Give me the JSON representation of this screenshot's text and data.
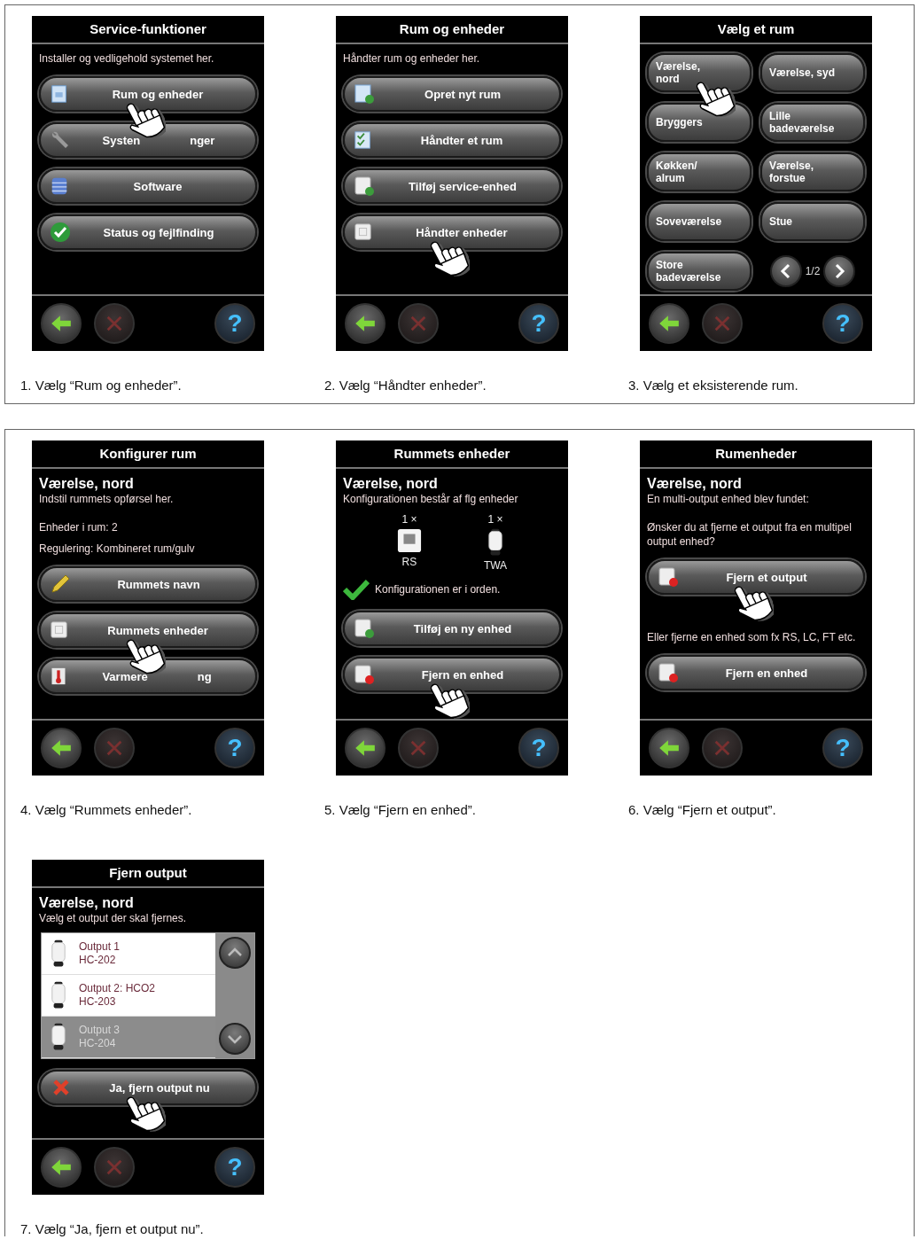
{
  "panels": [
    {
      "steps": [
        {
          "caption": "1. Vælg “Rum og enheder”.",
          "screen": {
            "title": "Service-funktioner",
            "help": "?",
            "blocks": [
              {
                "kind": "text",
                "text": "Installer og vedligehold systemet her."
              },
              {
                "kind": "button",
                "label_parts": [
                  "Rum og enheder"
                ],
                "pointed": true
              },
              {
                "kind": "button",
                "label_parts": [
                  "Systen",
                  "nger"
                ],
                "pointed": false
              },
              {
                "kind": "button",
                "label_parts": [
                  "Software"
                ],
                "pointed": false
              },
              {
                "kind": "button",
                "label_parts": [
                  "Status og fejlfinding"
                ],
                "pointed": false
              }
            ]
          }
        },
        {
          "caption": "2. Vælg “Håndter enheder”.",
          "screen": {
            "title": "Rum og enheder",
            "help": "?",
            "blocks": [
              {
                "kind": "text",
                "text": "Håndter rum og enheder her."
              },
              {
                "kind": "button",
                "label_parts": [
                  "Opret nyt rum"
                ],
                "pointed": false
              },
              {
                "kind": "button",
                "label_parts": [
                  "Håndter et rum"
                ],
                "pointed": false
              },
              {
                "kind": "button",
                "label_parts": [
                  "Tilføj service-enhed"
                ],
                "pointed": false
              },
              {
                "kind": "button",
                "label_parts": [
                  "Håndter enheder"
                ],
                "pointed": true
              }
            ]
          }
        },
        {
          "caption": "3. Vælg et eksisterende rum.",
          "screen": {
            "title": "Vælg et rum",
            "help": "?",
            "blocks": [
              {
                "kind": "rooms",
                "pager": "1/2",
                "rooms": [
                  {
                    "lines": [
                      "Værelse,",
                      "nord"
                    ],
                    "pointed": true
                  },
                  {
                    "lines": [
                      "Værelse, syd"
                    ],
                    "pointed": false
                  },
                  {
                    "lines": [
                      "Bryggers"
                    ],
                    "pointed": false
                  },
                  {
                    "lines": [
                      "Lille",
                      "badeværelse"
                    ],
                    "pointed": false
                  },
                  {
                    "lines": [
                      "Køkken/",
                      "alrum"
                    ],
                    "pointed": false
                  },
                  {
                    "lines": [
                      "Værelse,",
                      "forstue"
                    ],
                    "pointed": false
                  },
                  {
                    "lines": [
                      "Soveværelse"
                    ],
                    "pointed": false
                  },
                  {
                    "lines": [
                      "Stue"
                    ],
                    "pointed": false
                  },
                  {
                    "lines": [
                      "Store",
                      "badeværelse"
                    ],
                    "pointed": false
                  }
                ]
              }
            ]
          }
        }
      ]
    },
    {
      "steps": [
        {
          "caption": "4. Vælg “Rummets enheder”.",
          "screen": {
            "title": "Konfigurer rum",
            "help": "?",
            "blocks": [
              {
                "kind": "heading",
                "text": "Værelse, nord"
              },
              {
                "kind": "text",
                "text": "Indstil rummets opførsel her."
              },
              {
                "kind": "note",
                "text": "Enheder i rum: 2"
              },
              {
                "kind": "text",
                "text": "Regulering: Kombineret rum/gulv"
              },
              {
                "kind": "button",
                "label_parts": [
                  "Rummets navn"
                ],
                "pointed": false
              },
              {
                "kind": "button",
                "label_parts": [
                  "Rummets enheder"
                ],
                "pointed": true
              },
              {
                "kind": "button",
                "label_parts": [
                  "Varmere",
                  "ng"
                ],
                "pointed": false
              }
            ]
          }
        },
        {
          "caption": "5. Vælg “Fjern en enhed”.",
          "screen": {
            "title": "Rummets enheder",
            "help": "?",
            "blocks": [
              {
                "kind": "heading",
                "text": "Værelse, nord"
              },
              {
                "kind": "text",
                "text": "Konfigurationen består af flg enheder"
              },
              {
                "kind": "devices",
                "devices": [
                  {
                    "count": "1 ×",
                    "name": "RS"
                  },
                  {
                    "count": "1 ×",
                    "name": "TWA"
                  }
                ]
              },
              {
                "kind": "status",
                "ok": true,
                "text": "Konfigurationen er i orden."
              },
              {
                "kind": "button",
                "label_parts": [
                  "Tilføj en ny enhed"
                ],
                "pointed": false
              },
              {
                "kind": "button",
                "label_parts": [
                  "Fjern en enhed"
                ],
                "pointed": true
              }
            ]
          }
        },
        {
          "caption": "6. Vælg “Fjern et output”.",
          "screen": {
            "title": "Rumenheder",
            "help": "?",
            "blocks": [
              {
                "kind": "heading",
                "text": "Værelse, nord"
              },
              {
                "kind": "text",
                "text": "En multi-output enhed blev fundet:"
              },
              {
                "kind": "note",
                "text": "Ønsker du at fjerne et output fra en multipel output enhed?"
              },
              {
                "kind": "button",
                "label_parts": [
                  "Fjern et output"
                ],
                "pointed": true
              },
              {
                "kind": "note",
                "text": "Eller fjerne en enhed som fx RS, LC, FT etc."
              },
              {
                "kind": "button",
                "label_parts": [
                  "Fjern en enhed"
                ],
                "pointed": false
              }
            ]
          }
        },
        {
          "caption": "7.  Vælg “Ja, fjern et output nu”.",
          "screen": {
            "title": "Fjern output",
            "help": "?",
            "blocks": [
              {
                "kind": "heading",
                "text": "Værelse, nord"
              },
              {
                "kind": "text",
                "text": "Vælg et output der skal fjernes."
              },
              {
                "kind": "outputs",
                "items": [
                  {
                    "name": "Output 1",
                    "model": "HC-202",
                    "selected": false
                  },
                  {
                    "name": "Output 2: HCO2",
                    "model": "HC-203",
                    "selected": false
                  },
                  {
                    "name": "Output 3",
                    "model": "HC-204",
                    "selected": true
                  }
                ]
              },
              {
                "kind": "button",
                "label_parts": [
                  "Ja, fjern output nu"
                ],
                "pointed": true
              }
            ]
          }
        }
      ]
    }
  ]
}
